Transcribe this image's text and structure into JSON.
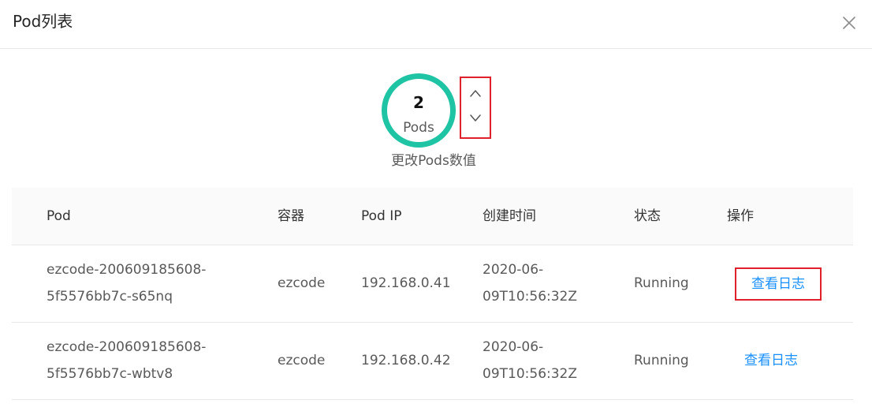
{
  "dialog": {
    "title": "Pod列表"
  },
  "pods": {
    "count": "2",
    "label": "Pods",
    "hint": "更改Pods数值"
  },
  "table": {
    "headers": [
      "Pod",
      "容器",
      "Pod IP",
      "创建时间",
      "状态",
      "操作"
    ],
    "rows": [
      {
        "pod_line1": "ezcode-200609185608-",
        "pod_line2": "5f5576bb7c-s65nq",
        "container": "ezcode",
        "ip": "192.168.0.41",
        "created_line1": "2020-06-",
        "created_line2": "09T10:56:32Z",
        "status": "Running",
        "action": "查看日志"
      },
      {
        "pod_line1": "ezcode-200609185608-",
        "pod_line2": "5f5576bb7c-wbtv8",
        "container": "ezcode",
        "ip": "192.168.0.42",
        "created_line1": "2020-06-",
        "created_line2": "09T10:56:32Z",
        "status": "Running",
        "action": "查看日志"
      }
    ]
  },
  "colors": {
    "ring": "#1ec4a4",
    "link": "#1890ff",
    "highlight_border": "#e0202a"
  },
  "icons": {
    "close": "close-icon",
    "increase": "chevron-up-icon",
    "decrease": "chevron-down-icon"
  }
}
